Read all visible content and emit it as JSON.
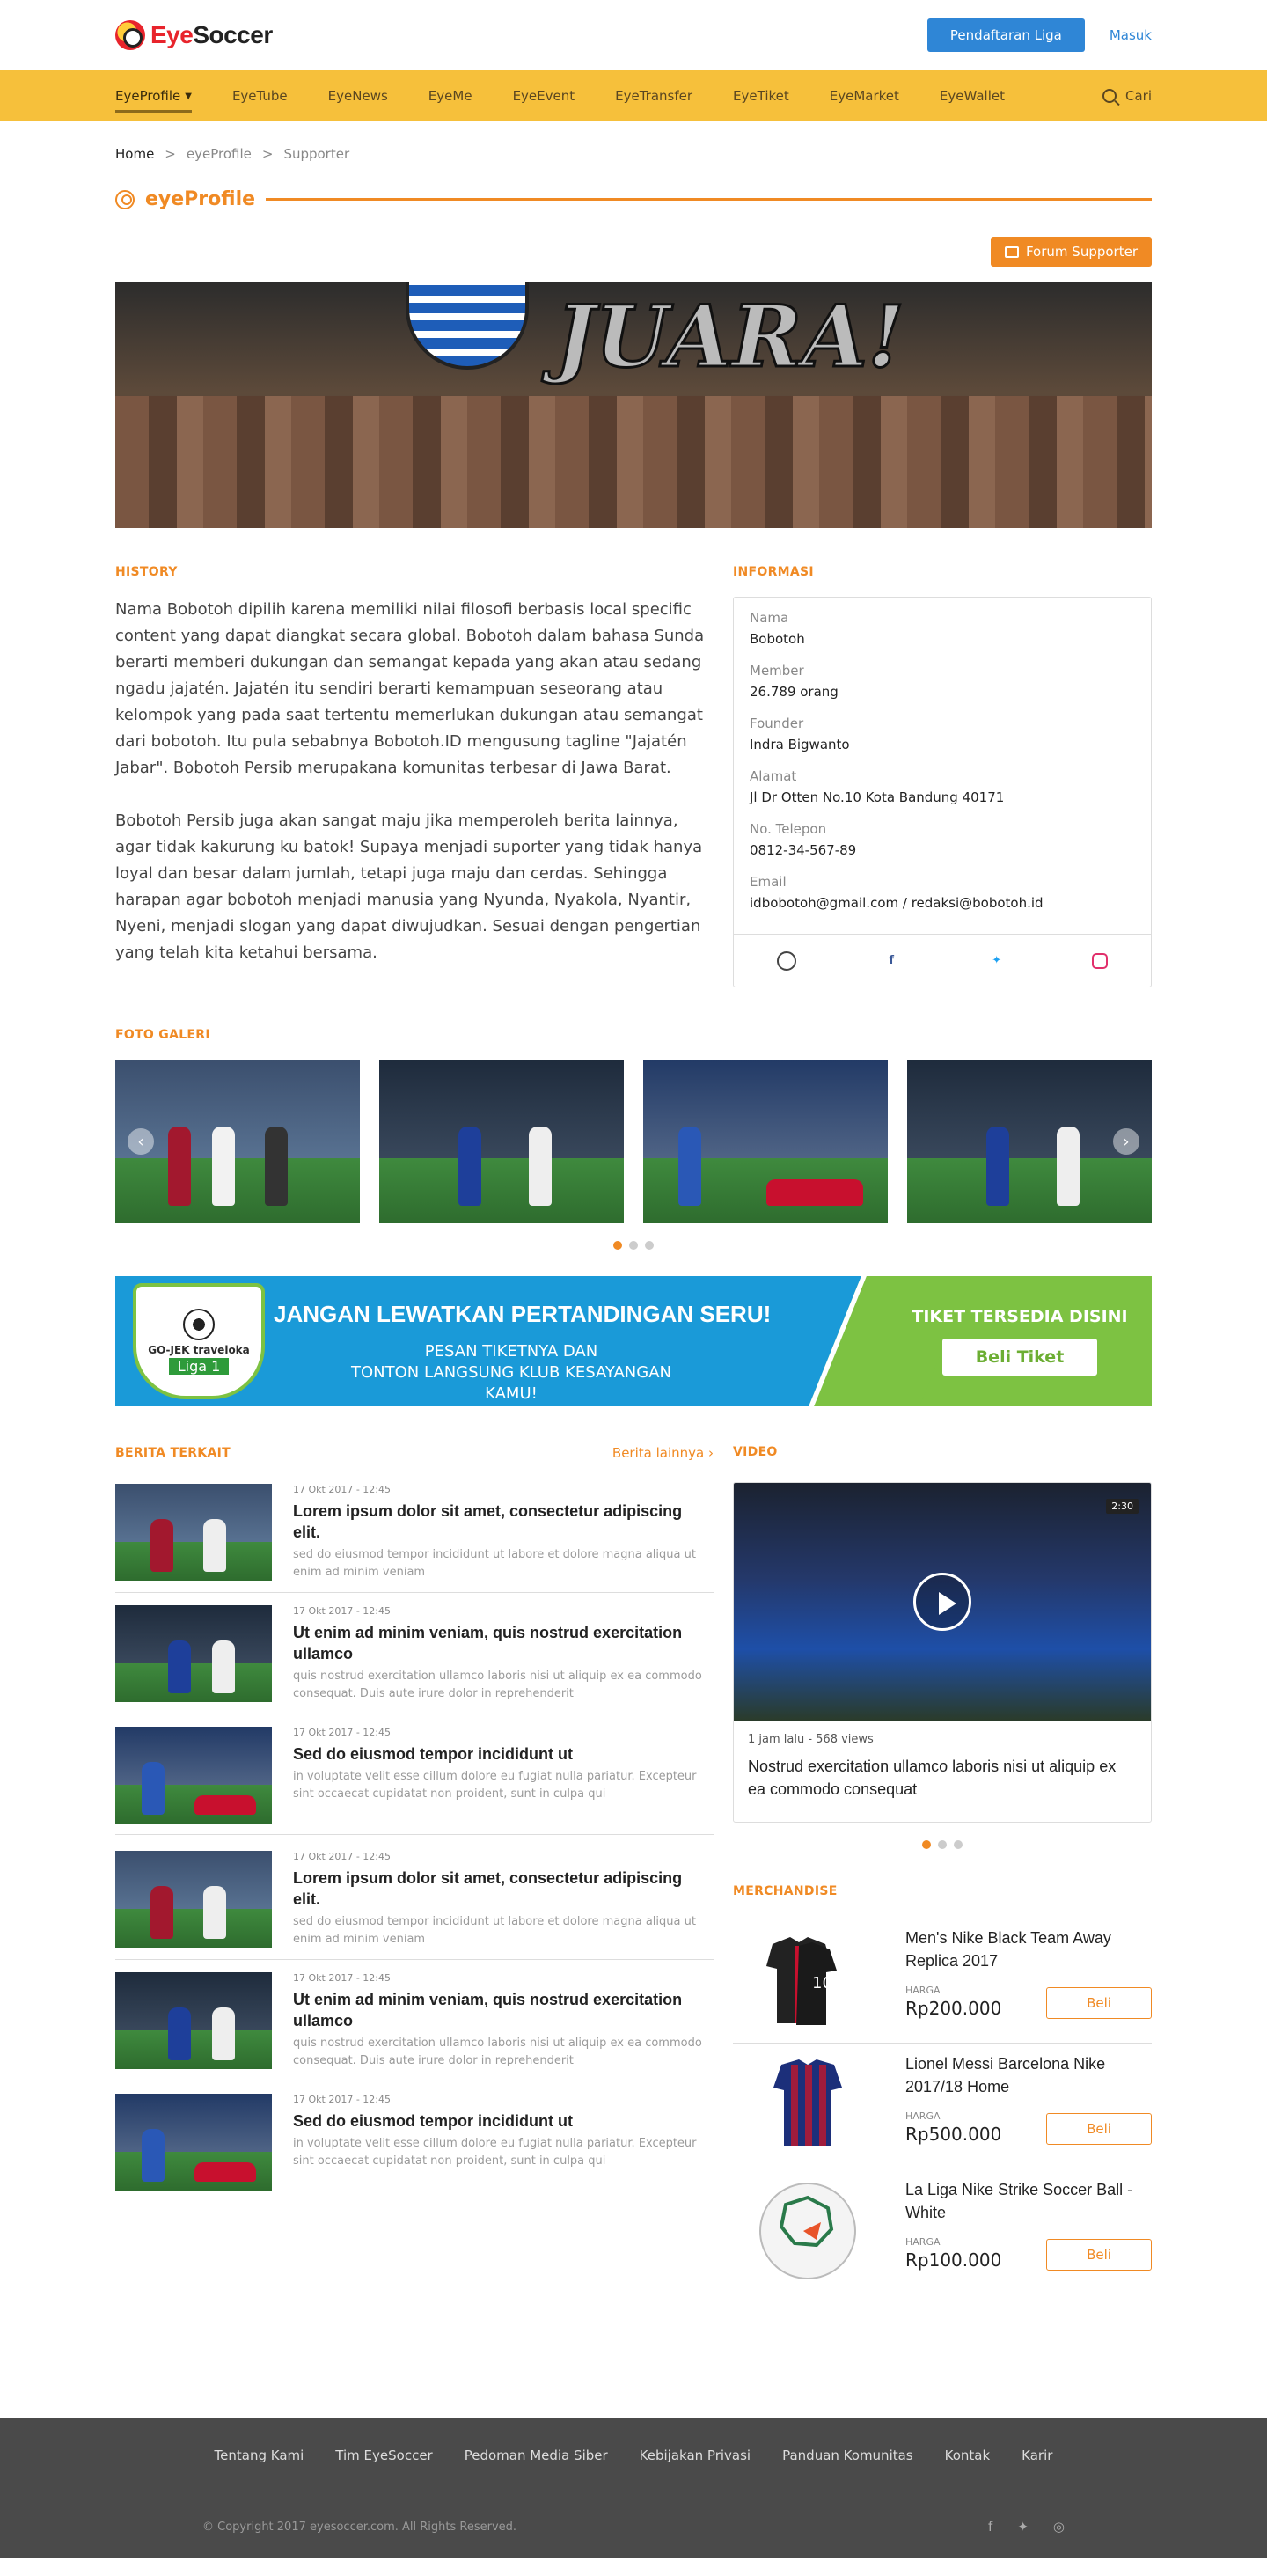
{
  "header": {
    "logo_main": "Eye",
    "logo_bold": "Soccer",
    "league_button": "Pendaftaran Liga",
    "login_link": "Masuk"
  },
  "nav": {
    "items": [
      "EyeProfile",
      "EyeTube",
      "EyeNews",
      "EyeMe",
      "EyeEvent",
      "EyeTransfer",
      "EyeTiket",
      "EyeMarket",
      "EyeWallet"
    ],
    "search_label": "Cari"
  },
  "breadcrumb": {
    "home": "Home",
    "sep": ">",
    "level1": "eyeProfile",
    "level2": "Supporter"
  },
  "page": {
    "title": "eyeProfile",
    "forum_button": "Forum Supporter"
  },
  "hero": {
    "banner_text": "JUARA!"
  },
  "history": {
    "label": "HISTORY",
    "paragraphs": [
      "Nama Bobotoh dipilih karena memiliki nilai filosofi berbasis local specific content yang dapat diangkat secara global. Bobotoh dalam bahasa Sunda berarti memberi dukungan dan semangat kepada yang akan atau sedang ngadu jajatén. Jajatén itu sendiri berarti kemampuan seseorang atau kelompok  yang pada saat tertentu memerlukan dukungan atau semangat dari bobotoh. Itu pula sebabnya Bobotoh.ID mengusung tagline \"Jajatén Jabar\". Bobotoh Persib merupakana komunitas terbesar di Jawa Barat.",
      "Bobotoh Persib juga akan sangat maju jika memperoleh berita lainnya, agar tidak kakurung ku batok! Supaya menjadi suporter yang tidak hanya loyal dan besar dalam jumlah, tetapi juga maju dan cerdas. Sehingga harapan agar bobotoh menjadi manusia yang Nyunda, Nyakola, Nyantir, Nyeni, menjadi slogan yang dapat diwujudkan. Sesuai dengan pengertian yang telah kita ketahui bersama."
    ]
  },
  "informasi": {
    "label": "INFORMASI",
    "rows": [
      {
        "label": "Nama",
        "value": "Bobotoh"
      },
      {
        "label": "Member",
        "value": "26.789 orang"
      },
      {
        "label": "Founder",
        "value": "Indra Bigwanto"
      },
      {
        "label": "Alamat",
        "value": "Jl Dr Otten No.10 Kota Bandung 40171"
      },
      {
        "label": "No. Telepon",
        "value": "0812-34-567-89"
      },
      {
        "label": "Email",
        "value": "idbobotoh@gmail.com / redaksi@bobotoh.id"
      }
    ],
    "social_icons": [
      "globe-icon",
      "facebook-icon",
      "twitter-icon",
      "instagram-icon"
    ]
  },
  "gallery": {
    "label": "FOTO GALERI",
    "count": 4,
    "dots": 3,
    "active_dot": 1
  },
  "ad": {
    "headline": "JANGAN LEWATKAN PERTANDINGAN SERU!",
    "sub_line1": "PESAN TIKETNYA DAN",
    "sub_line2": "TONTON LANGSUNG KLUB KESAYANGAN KAMU!",
    "sponsor": "GO-JEK traveloka",
    "league": "Liga 1",
    "ticket_text": "TIKET TERSEDIA DISINI",
    "ticket_button": "Beli Tiket"
  },
  "news": {
    "label": "BERITA TERKAIT",
    "more": "Berita lainnya",
    "items": [
      {
        "date": "17 Okt 2017 - 12:45",
        "title": "Lorem ipsum dolor sit amet, consectetur adipiscing elit.",
        "snippet": "sed do eiusmod tempor incididunt ut labore et dolore magna aliqua ut enim ad minim veniam"
      },
      {
        "date": "17 Okt 2017 - 12:45",
        "title": "Ut enim ad minim veniam, quis nostrud exercitation ullamco",
        "snippet": "quis nostrud exercitation ullamco laboris nisi ut aliquip ex ea commodo consequat. Duis aute irure dolor in reprehenderit"
      },
      {
        "date": "17 Okt 2017 - 12:45",
        "title": "Sed do eiusmod tempor incididunt ut",
        "snippet": "in voluptate velit esse cillum dolore eu fugiat nulla pariatur. Excepteur sint occaecat cupidatat non proident, sunt in culpa qui"
      },
      {
        "date": "17 Okt 2017 - 12:45",
        "title": "Lorem ipsum dolor sit amet, consectetur adipiscing elit.",
        "snippet": "sed do eiusmod tempor incididunt ut labore et dolore magna aliqua ut enim ad minim veniam"
      },
      {
        "date": "17 Okt 2017 - 12:45",
        "title": "Ut enim ad minim veniam, quis nostrud exercitation ullamco",
        "snippet": "quis nostrud exercitation ullamco laboris nisi ut aliquip ex ea commodo consequat. Duis aute irure dolor in reprehenderit"
      },
      {
        "date": "17 Okt 2017 - 12:45",
        "title": "Sed do eiusmod tempor incididunt ut",
        "snippet": "in voluptate velit esse cillum dolore eu fugiat nulla pariatur. Excepteur sint occaecat cupidatat non proident, sunt in culpa qui"
      }
    ]
  },
  "video": {
    "label": "VIDEO",
    "duration": "2:30",
    "meta": "1 jam lalu - 568 views",
    "title": "Nostrud exercitation ullamco laboris nisi ut aliquip ex ea commodo consequat",
    "dots": 3,
    "active_dot": 1
  },
  "merch": {
    "label": "MERCHANDISE",
    "price_label": "HARGA",
    "buy_label": "Beli",
    "items": [
      {
        "name": "Men's Nike Black Team Away Replica 2017",
        "price": "Rp200.000"
      },
      {
        "name": "Lionel Messi Barcelona Nike 2017/18 Home",
        "price": "Rp500.000"
      },
      {
        "name": "La Liga Nike Strike Soccer Ball - White",
        "price": "Rp100.000"
      }
    ]
  },
  "footer": {
    "links": [
      "Tentang Kami",
      "Tim EyeSoccer",
      "Pedoman Media Siber",
      "Kebijakan Privasi",
      "Panduan Komunitas",
      "Kontak",
      "Karir"
    ],
    "copyright": "© Copyright 2017 eyesoccer.com. All Rights Reserved."
  },
  "colors": {
    "accent": "#f08a24",
    "nav_bg": "#f6c03b",
    "primary_blue": "#2f86d6",
    "footer_bg": "#4a4a4a"
  }
}
